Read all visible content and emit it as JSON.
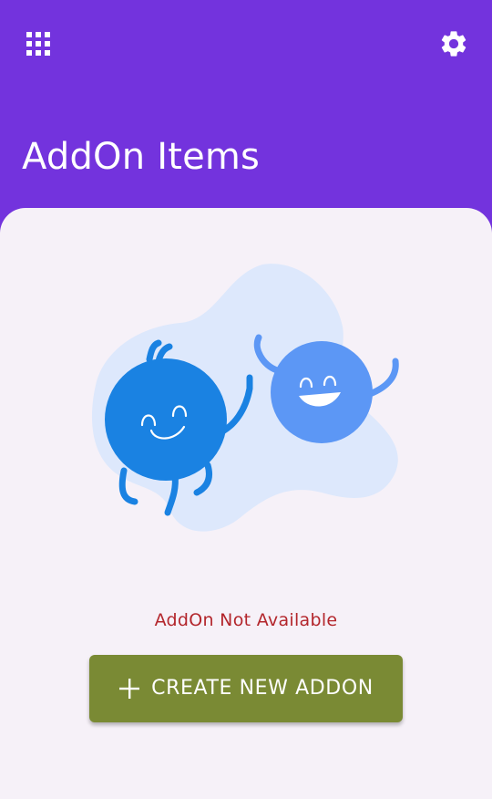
{
  "header": {
    "title": "AddOn Items",
    "apps_icon": "apps-grid-icon",
    "settings_icon": "gear-icon"
  },
  "empty_state": {
    "illustration": "two-happy-characters-illustration",
    "message": "AddOn Not Available"
  },
  "actions": {
    "create_label": "CREATE NEW ADDON",
    "create_icon": "plus-icon"
  },
  "colors": {
    "header_bg": "#7333DD",
    "card_bg": "#F6F1F8",
    "message": "#B3262C",
    "button_bg": "#7A8A34",
    "blob": "#DDE8FC",
    "character_dark": "#1A82E2",
    "character_light": "#5C97F5"
  }
}
